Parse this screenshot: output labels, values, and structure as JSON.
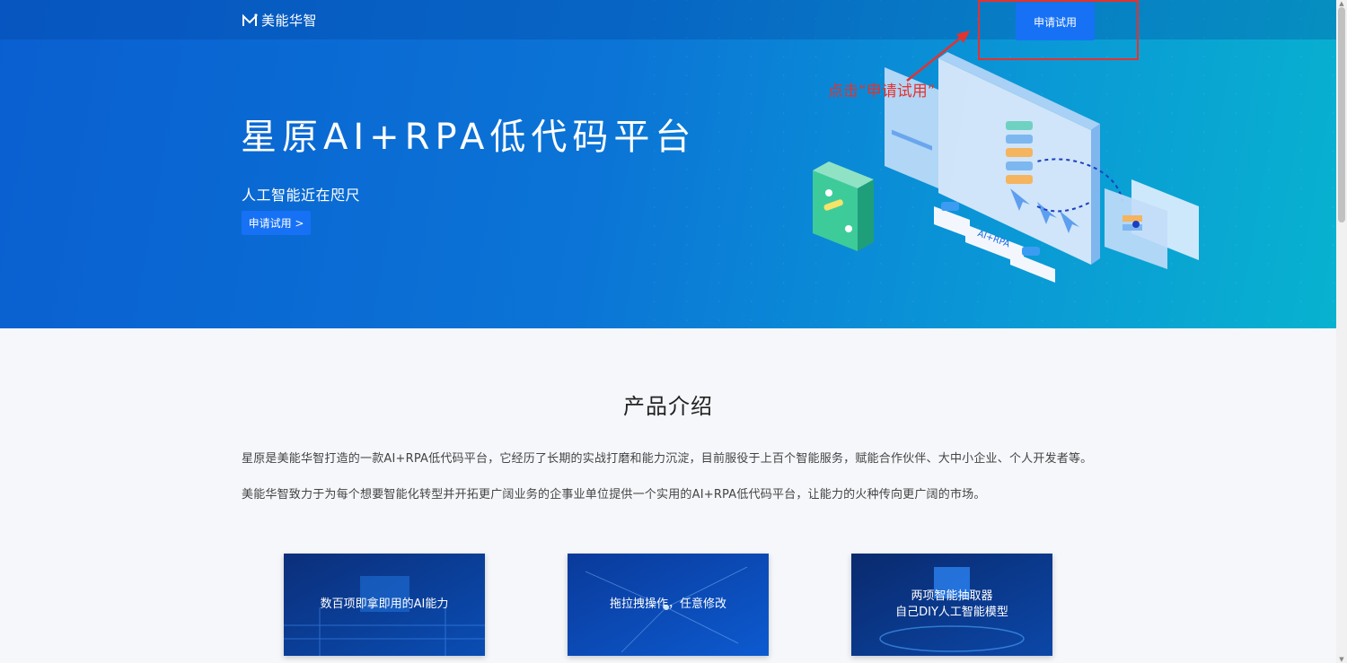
{
  "header": {
    "brand": "美能华智",
    "nav_trial_label": "申请试用"
  },
  "hero": {
    "title": "星原AI+RPA低代码平台",
    "subtitle": "人工智能近在咫尺",
    "cta_label": "申请试用 >",
    "illustration_badge": "AI+RPA"
  },
  "annotation": {
    "text": "点击“申请试用”",
    "color": "#e5322d"
  },
  "intro": {
    "title": "产品介绍",
    "paragraphs": [
      "星原是美能华智打造的一款AI+RPA低代码平台，它经历了长期的实战打磨和能力沉淀，目前服役于上百个智能服务，赋能合作伙伴、大中小企业、个人开发者等。",
      "美能华智致力于为每个想要智能化转型并开拓更广阔业务的企事业单位提供一个实用的AI+RPA低代码平台，让能力的火种传向更广阔的市场。"
    ]
  },
  "cards": [
    {
      "label": "数百项即拿即用的AI能力"
    },
    {
      "label": "拖拉拽操作，任意修改"
    },
    {
      "label": "两项智能抽取器\n自己DIY人工智能模型"
    }
  ],
  "colors": {
    "primary_button": "#1671f5",
    "hero_gradient_start": "#0a5fd0",
    "hero_gradient_end": "#08b2cf"
  }
}
